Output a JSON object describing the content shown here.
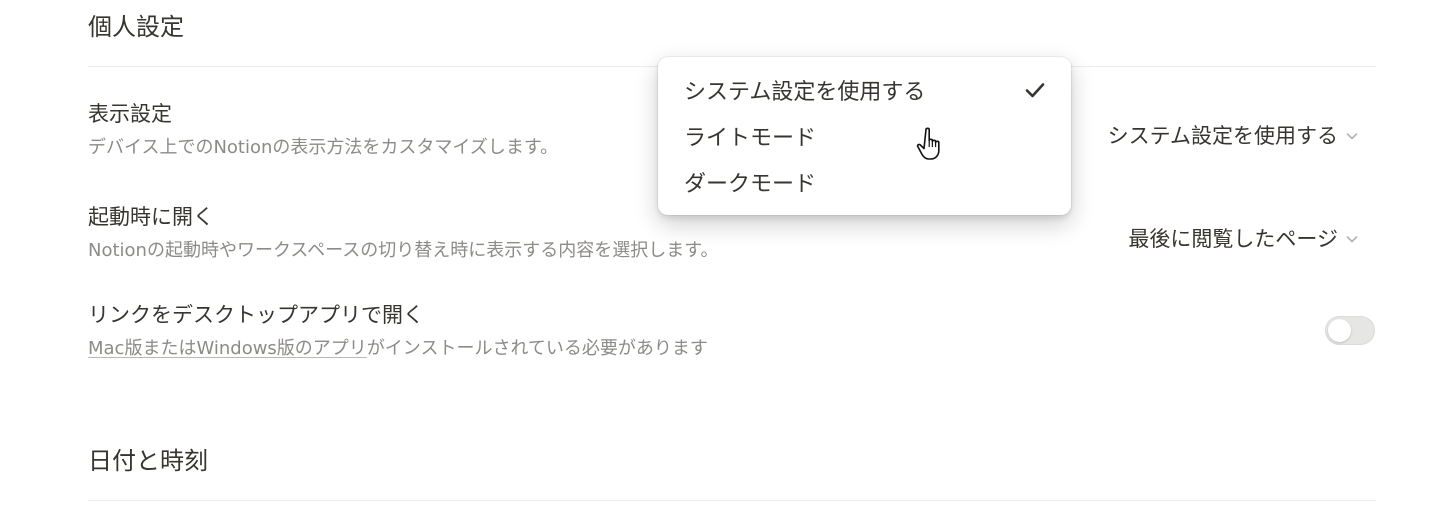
{
  "personal": {
    "title": "個人設定"
  },
  "appearance": {
    "label": "表示設定",
    "description": "デバイス上でのNotionの表示方法をカスタマイズします。",
    "selected": "システム設定を使用する",
    "menu": {
      "options": [
        "システム設定を使用する",
        "ライトモード",
        "ダークモード"
      ],
      "checked_index": 0
    }
  },
  "startup": {
    "label": "起動時に開く",
    "description": "Notionの起動時やワークスペースの切り替え時に表示する内容を選択します。",
    "selected": "最後に閲覧したページ"
  },
  "desktop_links": {
    "label": "リンクをデスクトップアプリで開く",
    "description_link": "Mac版またはWindows版のアプリ",
    "description_rest": "がインストールされている必要があります",
    "enabled": false
  },
  "datetime": {
    "title": "日付と時刻"
  },
  "icons": {
    "chevron": "chevron-down-icon",
    "check": "check-icon",
    "cursor": "hand-pointer-cursor"
  }
}
